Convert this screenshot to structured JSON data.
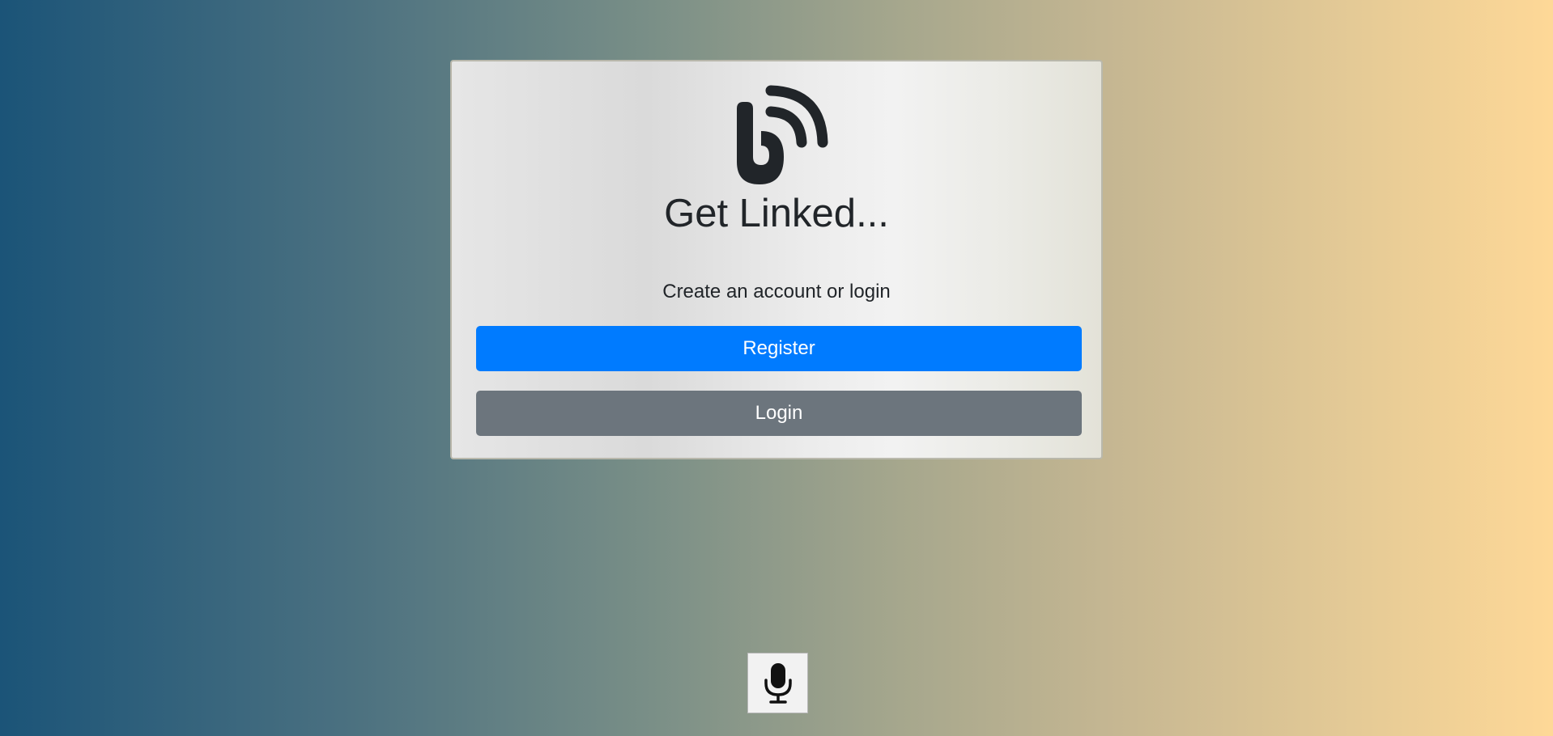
{
  "app": {
    "title": "Get Linked...",
    "logo_icon": "broadcast-b-logo"
  },
  "card": {
    "subtitle": "Create an account or login",
    "register_label": "Register",
    "login_label": "Login"
  },
  "voice": {
    "icon": "microphone-icon"
  },
  "colors": {
    "primary": "#007bff",
    "secondary": "#6c757d",
    "text": "#212529",
    "gradient_start": "#1b5478",
    "gradient_end": "#fed897"
  }
}
